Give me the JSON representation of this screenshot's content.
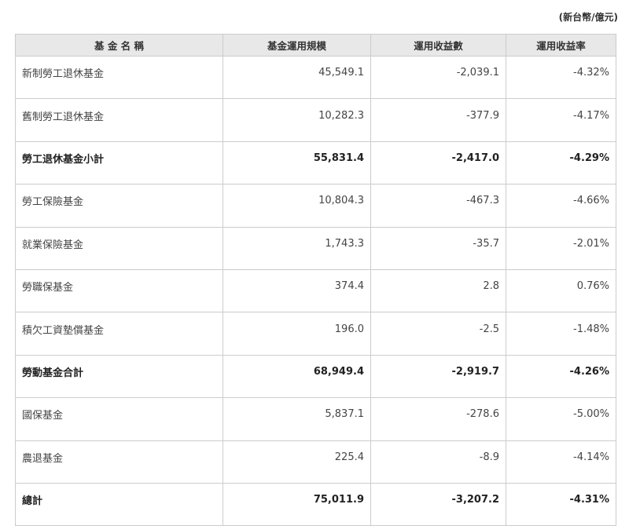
{
  "unit_label": "(新台幣/億元)",
  "table": {
    "headers": [
      "基 金 名 稱",
      "基金運用規模",
      "運用收益數",
      "運用收益率"
    ],
    "rows": [
      {
        "name": "新制勞工退休基金",
        "scale": "45,549.1",
        "income": "-2,039.1",
        "rate": "-4.32%",
        "bold": false
      },
      {
        "name": "舊制勞工退休基金",
        "scale": "10,282.3",
        "income": "-377.9",
        "rate": "-4.17%",
        "bold": false
      },
      {
        "name": "勞工退休基金小計",
        "scale": "55,831.4",
        "income": "-2,417.0",
        "rate": "-4.29%",
        "bold": true
      },
      {
        "name": "勞工保險基金",
        "scale": "10,804.3",
        "income": "-467.3",
        "rate": "-4.66%",
        "bold": false
      },
      {
        "name": "就業保險基金",
        "scale": "1,743.3",
        "income": "-35.7",
        "rate": "-2.01%",
        "bold": false
      },
      {
        "name": "勞職保基金",
        "scale": "374.4",
        "income": "2.8",
        "rate": "0.76%",
        "bold": false
      },
      {
        "name": "積欠工資墊償基金",
        "scale": "196.0",
        "income": "-2.5",
        "rate": "-1.48%",
        "bold": false
      },
      {
        "name": "勞動基金合計",
        "scale": "68,949.4",
        "income": "-2,919.7",
        "rate": "-4.26%",
        "bold": true
      },
      {
        "name": "國保基金",
        "scale": "5,837.1",
        "income": "-278.6",
        "rate": "-5.00%",
        "bold": false
      },
      {
        "name": "農退基金",
        "scale": "225.4",
        "income": "-8.9",
        "rate": "-4.14%",
        "bold": false
      },
      {
        "name": "總計",
        "scale": "75,011.9",
        "income": "-3,207.2",
        "rate": "-4.31%",
        "bold": true
      }
    ]
  }
}
